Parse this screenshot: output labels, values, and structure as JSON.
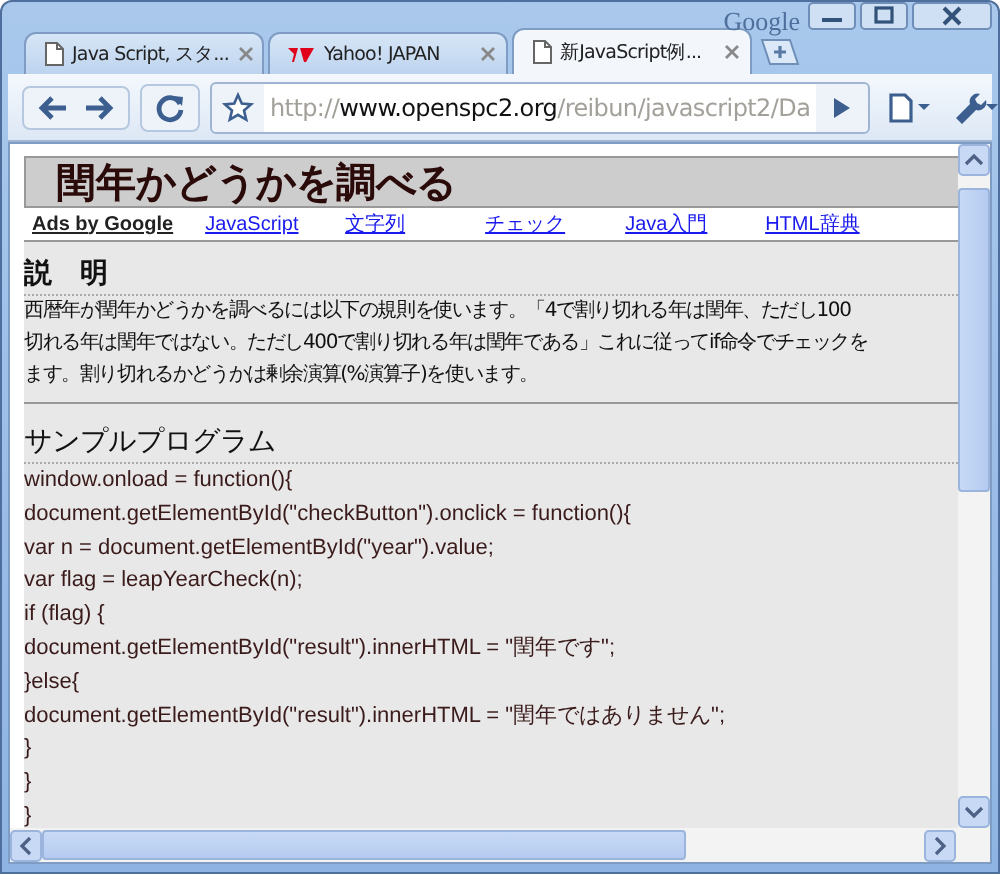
{
  "window": {
    "brand": "Google"
  },
  "tabs": [
    {
      "title": "Java Script, スタ...",
      "kind": "page",
      "selected": false
    },
    {
      "title": "Yahoo!  JAPAN",
      "kind": "logo",
      "selected": false
    },
    {
      "title": "新JavaScript例...",
      "kind": "page",
      "selected": true
    }
  ],
  "address_bar": {
    "scheme": "http://",
    "host": "www.openspc2.org",
    "path": "/reibun/javascript2/Da"
  },
  "page": {
    "heading": "閏年かどうかを調べる",
    "ads_label": "Ads by Google",
    "ad_links": [
      "JavaScript",
      "文字列",
      "チェック",
      "Java入門",
      "HTML辞典"
    ],
    "sections": [
      {
        "title": "説　明",
        "kind": "text",
        "lines": [
          "西暦年が閏年かどうかを調べるには以下の規則を使います。「4で割り切れる年は閏年、ただし100",
          "切れる年は閏年ではない。ただし400で割り切れる年は閏年である」これに従ってif命令でチェックを",
          "ます。割り切れるかどうかは剰余演算(%演算子)を使います。"
        ]
      },
      {
        "title": "サンプルプログラム",
        "kind": "code",
        "lines": [
          "window.onload = function(){",
          "document.getElementById(\"checkButton\").onclick = function(){",
          "var n = document.getElementById(\"year\").value;",
          "var flag = leapYearCheck(n);",
          "if (flag) {",
          "document.getElementById(\"result\").innerHTML = \"閏年です\";",
          "}else{",
          "document.getElementById(\"result\").innerHTML = \"閏年ではありません\";",
          "}",
          "}",
          "}"
        ]
      }
    ]
  }
}
